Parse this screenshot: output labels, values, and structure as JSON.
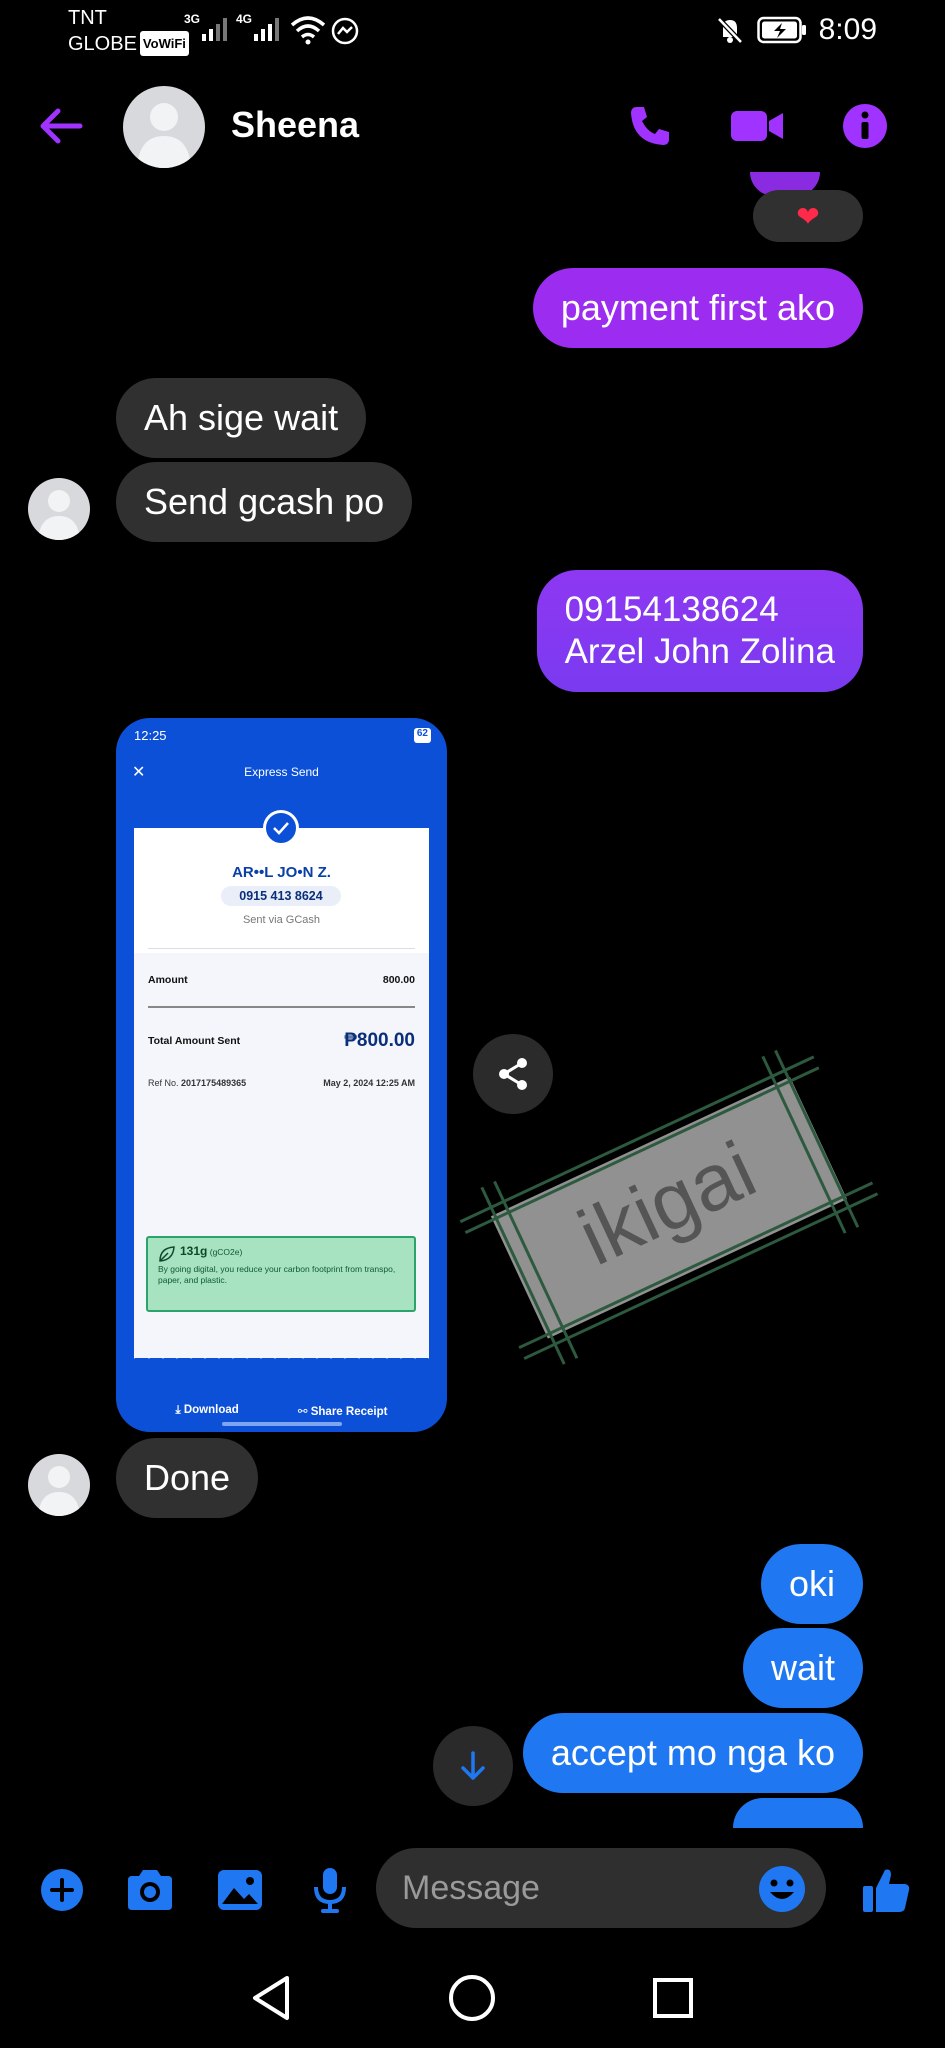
{
  "status_bar": {
    "carrier_1": "TNT",
    "carrier_2": "GLOBE",
    "vowifi": "VoWiFi",
    "net_1": "3G",
    "net_2": "4G",
    "battery_level": "charging",
    "time": "8:09"
  },
  "header": {
    "contact_name": "Sheena",
    "accent_color": "#a033ff"
  },
  "messages": {
    "reaction": "❤",
    "m1": "payment first ako",
    "m2": "Ah sige wait",
    "m3": "Send gcash po",
    "m4_line1": "09154138624",
    "m4_line2": "Arzel John Zolina",
    "m6": "Done",
    "m7": "oki",
    "m8": "wait",
    "m9": "accept mo nga ko"
  },
  "receipt": {
    "time": "12:25",
    "battery": "62",
    "title": "Express Send",
    "recipient": "AR••L JO•N Z.",
    "number": "0915 413 8624",
    "via": "Sent via GCash",
    "amount_label": "Amount",
    "amount": "800.00",
    "total_label": "Total Amount Sent",
    "total": "₱800.00",
    "ref_label": "Ref No.",
    "ref": "2017175489365",
    "date": "May 2, 2024 12:25 AM",
    "eco_value": "131g",
    "eco_unit": "(gCO2e)",
    "eco_text": "By going digital, you reduce your carbon footprint from transpo, paper, and plastic.",
    "download": "Download",
    "share": "Share Receipt"
  },
  "watermark_text": "ikigai",
  "composer": {
    "placeholder": "Message",
    "accent_color": "#1f78f2"
  },
  "icons": {
    "back": "back-arrow-icon",
    "call": "phone-icon",
    "video": "video-icon",
    "info": "info-icon",
    "share": "share-icon",
    "scroll": "arrow-down-icon",
    "plus": "plus-icon",
    "camera": "camera-icon",
    "gallery": "image-icon",
    "mic": "microphone-icon",
    "emoji": "emoji-icon",
    "like": "thumbs-up-icon"
  }
}
